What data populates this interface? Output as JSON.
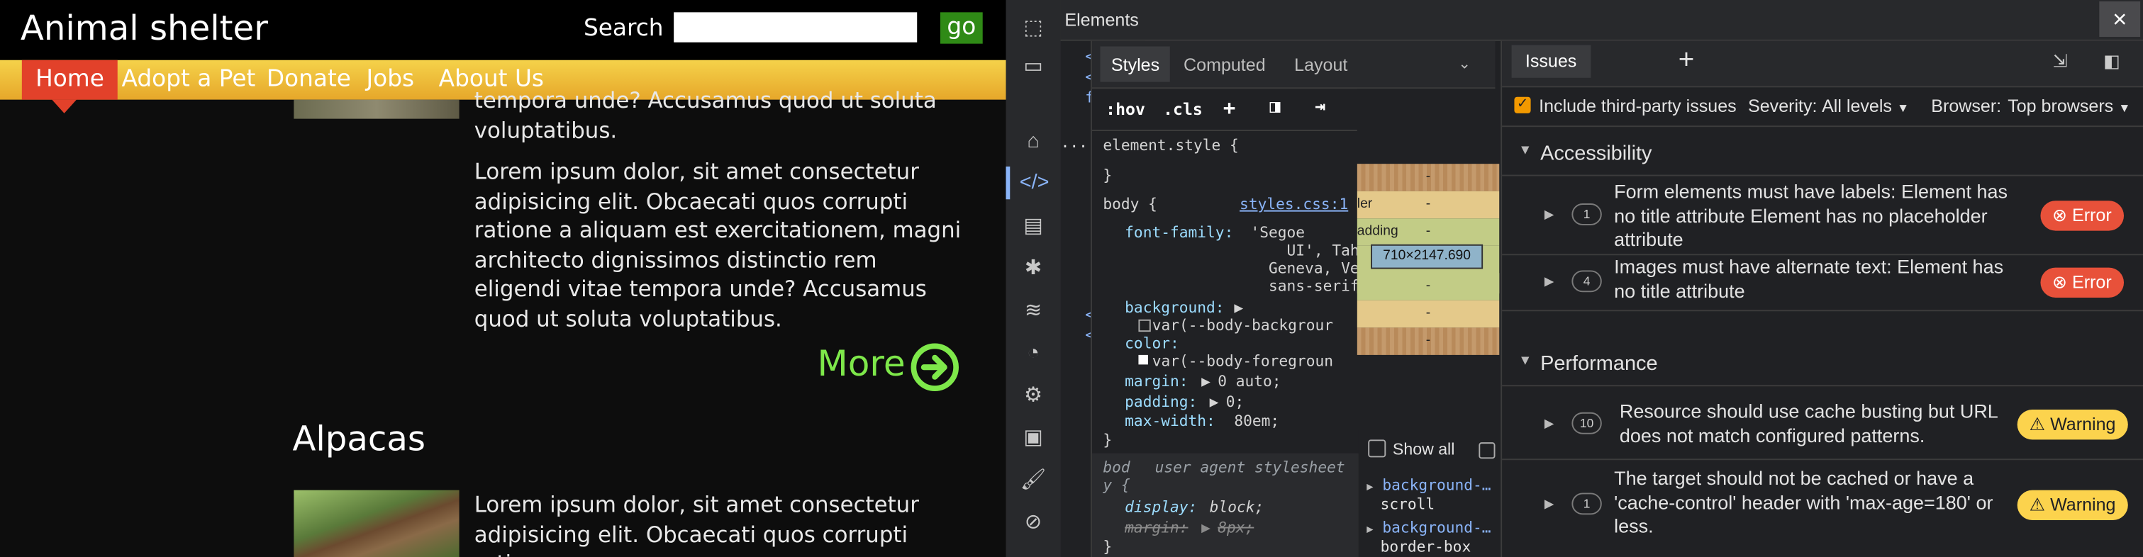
{
  "site": {
    "title": "Animal shelter",
    "search_label": "Search",
    "search_value": "",
    "go_label": "go",
    "nav": [
      "Home",
      "Adopt a Pet",
      "Donate",
      "Jobs",
      "About Us"
    ],
    "para_partial": "tempora unde? Accusamus quod ut soluta voluptatibus.",
    "para_full": "Lorem ipsum dolor, sit amet consectetur adipisicing elit. Obcaecati quos corrupti ratione a aliquam est exercitationem, magni architecto dignissimos distinctio rem eligendi vitae tempora unde? Accusamus quod ut soluta voluptatibus.",
    "more_label": "More",
    "section_title": "Alpacas",
    "para_bottom": "Lorem ipsum dolor, sit amet consectetur adipisicing elit. Obcaecati quos corrupti ratione"
  },
  "devtools": {
    "title": "Elements",
    "close_icon": "×",
    "dom_fragments": [
      "<",
      "<",
      "f",
      "<",
      "<",
      "..."
    ],
    "styles_tabs": [
      "Styles",
      "Computed",
      "Layout"
    ],
    "toolbar": {
      "hov": ":hov",
      "cls": ".cls",
      "plus": "+"
    },
    "element_style": "element.style {",
    "close_brace": "}",
    "rule_selector": "body {",
    "rule_source": "styles.css:1",
    "font_family_prop": "font-family:",
    "font_family_value": "'Segoe\n    UI', Tahoma,\n  Geneva, Verdana,\n  sans-serif;",
    "background_prop": "background:",
    "background_value": "var(--body-backgrour",
    "color_prop": "color:",
    "color_value": "var(--body-foregroun",
    "margin_prop": "margin:",
    "margin_value": "0 auto;",
    "padding_prop": "padding:",
    "padding_value": "0;",
    "maxwidth_prop": "max-width:",
    "maxwidth_value": "80em;",
    "ua_selector": "bod",
    "ua_selector2": "y {",
    "ua_label": "user agent stylesheet",
    "ua_display_prop": "display:",
    "ua_display_value": "block;",
    "ua_margin_prop": "margin:",
    "ua_margin_value": "8px;",
    "boxmodel": {
      "border_label": "ler",
      "padding_label": "adding",
      "size": "710×2147.690",
      "dash": "-"
    },
    "show_all": "Show all",
    "computed": [
      {
        "prop": "background-…",
        "value": "scroll"
      },
      {
        "prop": "background-…",
        "value": "border-box"
      }
    ],
    "issues": {
      "tab": "Issues",
      "include_third_party": "Include third-party issues",
      "severity_label": "Severity:",
      "severity_value": "All levels",
      "browser_label": "Browser:",
      "browser_value": "Top browsers",
      "groups": [
        {
          "name": "Accessibility",
          "items": [
            {
              "count": "1",
              "text": "Form elements must have labels: Element has no title attribute Element has no placeholder attribute",
              "badge": "Error"
            },
            {
              "count": "4",
              "text": "Images must have alternate text: Element has no title attribute",
              "badge": "Error"
            }
          ]
        },
        {
          "name": "Performance",
          "items": [
            {
              "count": "10",
              "text": "Resource should use cache busting but URL does not match configured patterns.",
              "badge": "Warning"
            },
            {
              "count": "1",
              "text": "The target should not be cached or have a 'cache-control' header with 'max-age=180' or less.",
              "badge": "Warning"
            }
          ]
        }
      ]
    }
  },
  "colors": {
    "nav_active": "#e2412a",
    "go_button": "#2f8a16",
    "more_link": "#7ee84a",
    "error_badge": "#e8513a",
    "warning_badge": "#fcd34d",
    "devtools_accent": "#8ab4f8"
  }
}
